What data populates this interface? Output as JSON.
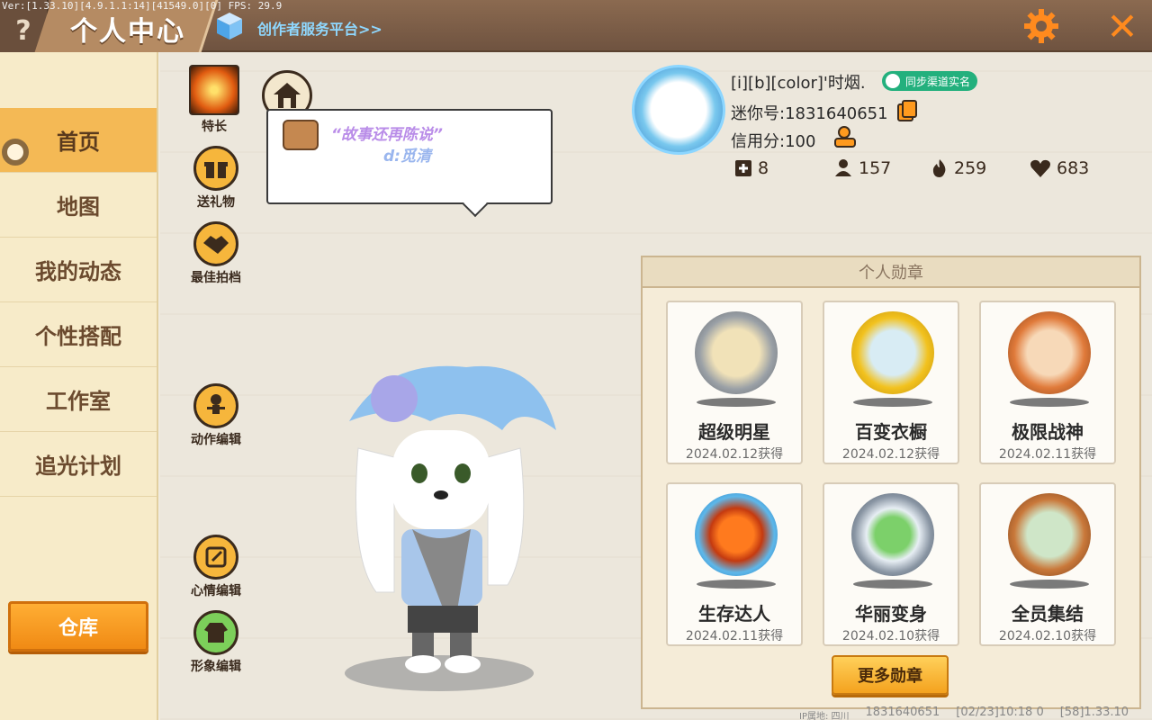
{
  "header": {
    "version": "Ver:[1.33.10][4.9.1.1:14][41549.0][0] FPS: 29.9",
    "help": "?",
    "title": "个人中心",
    "creator_link": "创作者服务平台>>",
    "close": "✕"
  },
  "nav": {
    "items": [
      {
        "label": "首页",
        "active": true
      },
      {
        "label": "地图"
      },
      {
        "label": "我的动态"
      },
      {
        "label": "个性搭配"
      },
      {
        "label": "工作室"
      },
      {
        "label": "追光计划"
      }
    ],
    "warehouse": "仓库"
  },
  "side_actions": {
    "specialty": "特长",
    "gift": "送礼物",
    "partner": "最佳拍档",
    "action_edit": "动作编辑",
    "mood_edit": "心情编辑",
    "image_edit": "形象编辑"
  },
  "speech": {
    "quote": "“故事还再陈说”",
    "signature": "d:觅清"
  },
  "profile": {
    "name": "[i][b][color]'时烟.",
    "sync_badge": "同步渠道实名",
    "mini_id": "迷你号:1831640651",
    "credit": "信用分:100",
    "stats": {
      "friends": "8",
      "fans": "157",
      "heat": "259",
      "likes": "683"
    }
  },
  "medals": {
    "header": "个人勋章",
    "items": [
      {
        "name": "超级明星",
        "date": "2024.02.12获得",
        "color": "#9aa0a6"
      },
      {
        "name": "百变衣橱",
        "date": "2024.02.12获得",
        "color": "#f2c21e"
      },
      {
        "name": "极限战神",
        "date": "2024.02.11获得",
        "color": "#c9783a"
      },
      {
        "name": "生存达人",
        "date": "2024.02.11获得",
        "color": "#5db7ea"
      },
      {
        "name": "华丽变身",
        "date": "2024.02.10获得",
        "color": "#8a96a4"
      },
      {
        "name": "全员集结",
        "date": "2024.02.10获得",
        "color": "#c9783a"
      }
    ],
    "more": "更多勋章"
  },
  "footer": {
    "ip": "IP属地: 四川",
    "uid": "1831640651",
    "time": "[02/23]10:18 0",
    "build": "[58]1.33.10"
  },
  "colors": {
    "accent_orange": "#f4a21e",
    "topbar_brown": "#7a5c46",
    "nav_active": "#f4b955",
    "link_blue": "#8fd8ff"
  }
}
